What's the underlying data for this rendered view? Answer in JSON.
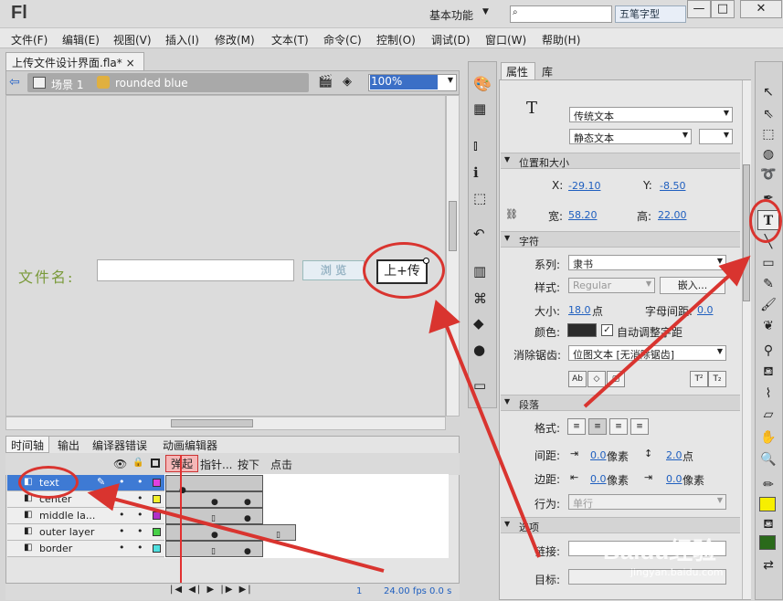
{
  "app": {
    "logo": "Fl",
    "workspace": "基本功能",
    "ime_label": "五笔字型",
    "win_min": "—",
    "win_max": "□",
    "win_close": "✕"
  },
  "menu": [
    "文件(F)",
    "编辑(E)",
    "视图(V)",
    "插入(I)",
    "修改(M)",
    "文本(T)",
    "命令(C)",
    "控制(O)",
    "调试(D)",
    "窗口(W)",
    "帮助(H)"
  ],
  "document": {
    "tab": "上传文件设计界面.fla*",
    "tab_close": "×",
    "scene": "场景 1",
    "symbol": "rounded blue",
    "zoom": "100%"
  },
  "stage": {
    "file_label": "文件名:",
    "browse_label": "浏 览",
    "upload_label": "上+传"
  },
  "timeline": {
    "tabs": [
      "时间轴",
      "输出",
      "编译器错误",
      "动画编辑器"
    ],
    "frame_labels": [
      "弹起",
      "指针...",
      "按下",
      "点击"
    ],
    "layers": [
      {
        "name": "text",
        "selected": true,
        "color": "#e040e0"
      },
      {
        "name": "center",
        "selected": false,
        "color": "#f4f02a"
      },
      {
        "name": "middle la...",
        "selected": false,
        "color": "#b030c8"
      },
      {
        "name": "outer layer",
        "selected": false,
        "color": "#48d048"
      },
      {
        "name": "border",
        "selected": false,
        "color": "#50e0e0"
      }
    ],
    "frame": "1",
    "fps": "24.00 fps",
    "time": "0.0 s"
  },
  "properties": {
    "tabs": [
      "属性",
      "库"
    ],
    "text_type": "传统文本",
    "text_subtype": "静态文本",
    "position_section": "位置和大小",
    "x_label": "X:",
    "x": "-29.10",
    "y_label": "Y:",
    "y": "-8.50",
    "w_label": "宽:",
    "w": "58.20",
    "h_label": "高:",
    "h": "22.00",
    "char_section": "字符",
    "family_label": "系列:",
    "family": "隶书",
    "style_label": "样式:",
    "style": "Regular",
    "embed": "嵌入...",
    "size_label": "大小:",
    "size": "18.0",
    "size_unit": "点",
    "spacing_label": "字母间距:",
    "spacing": "0.0",
    "color_label": "颜色:",
    "autokern": "自动调整字距",
    "aa_label": "消除锯齿:",
    "aa": "位图文本 [无消除锯齿]",
    "para_section": "段落",
    "format_label": "格式:",
    "spacing2_label": "间距:",
    "indent": "0.0",
    "indent_unit": "像素",
    "leading": "2.0",
    "leading_unit": "点",
    "margin_label": "边距:",
    "margin_l": "0.0",
    "margin_l_unit": "像素",
    "margin_r": "0.0",
    "margin_r_unit": "像素",
    "behavior_label": "行为:",
    "behavior": "单行",
    "options_section": "选项",
    "link_label": "链接:",
    "target_label": "目标:"
  },
  "watermark": {
    "text": "Baidu经验",
    "sub": "jingyan.baidu.com"
  },
  "colors": {
    "accent": "#3e7ad4",
    "annotation": "#d9342f",
    "fill": "#f7ef00",
    "stroke_color": "#2a6a1a"
  }
}
